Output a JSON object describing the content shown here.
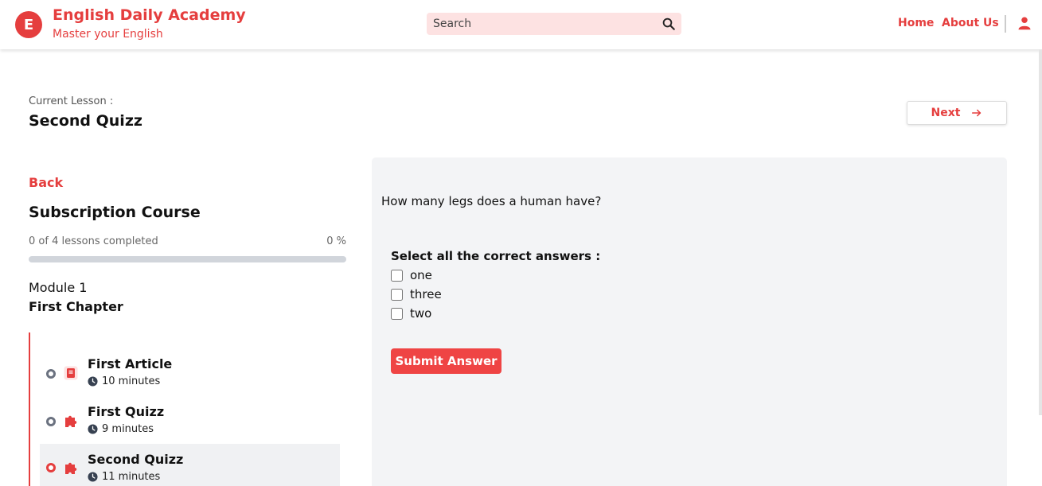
{
  "header": {
    "logo_letter": "E",
    "brand_title": "English Daily Academy",
    "brand_subtitle": "Master your English",
    "search_placeholder": "Search",
    "nav": {
      "home": "Home",
      "about": "About Us"
    },
    "accent_color": "#e53e3e"
  },
  "lesson_header": {
    "current_label": "Current Lesson :",
    "current_title": "Second Quizz",
    "next_label": "Next"
  },
  "sidebar": {
    "back_label": "Back",
    "course_title": "Subscription Course",
    "progress_text": "0 of 4 lessons completed",
    "progress_percent": "0 %",
    "progress_value": 0,
    "module_label": "Module 1",
    "chapter_title": "First Chapter",
    "lessons": [
      {
        "title": "First Article",
        "duration": "10 minutes",
        "icon": "book-icon",
        "active": false
      },
      {
        "title": "First Quizz",
        "duration": "9 minutes",
        "icon": "puzzle-icon",
        "active": false
      },
      {
        "title": "Second Quizz",
        "duration": "11 minutes",
        "icon": "puzzle-icon",
        "active": true
      }
    ]
  },
  "quiz": {
    "question": "How many legs does a human have?",
    "select_label": "Select all the correct answers :",
    "options": [
      "one",
      "three",
      "two"
    ],
    "submit_label": "Submit Answer"
  }
}
